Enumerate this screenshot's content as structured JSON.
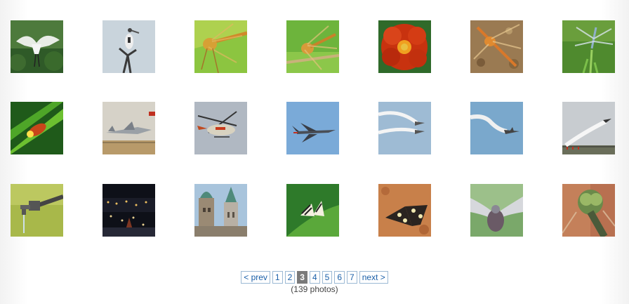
{
  "gallery": {
    "photos": [
      {
        "icon": "stork-in-flight-photo"
      },
      {
        "icon": "stork-on-branch-photo"
      },
      {
        "icon": "dragonfly-orange-photo"
      },
      {
        "icon": "dragonfly-on-twig-photo"
      },
      {
        "icon": "red-flower-photo"
      },
      {
        "icon": "dragonfly-on-soil-photo"
      },
      {
        "icon": "dragonfly-on-stem-photo"
      },
      {
        "icon": "firefly-on-leaf-photo"
      },
      {
        "icon": "jet-on-runway-photo"
      },
      {
        "icon": "helicopter-photo"
      },
      {
        "icon": "fighter-jet-photo"
      },
      {
        "icon": "jets-with-smoke-photo"
      },
      {
        "icon": "jet-smoke-trail-photo"
      },
      {
        "icon": "airshow-runway-photo"
      },
      {
        "icon": "water-tap-photo"
      },
      {
        "icon": "city-night-photo"
      },
      {
        "icon": "towers-photo"
      },
      {
        "icon": "butterfly-on-leaf-photo"
      },
      {
        "icon": "butterfly-on-ground-photo"
      },
      {
        "icon": "pigeon-photo"
      },
      {
        "icon": "dragonfly-closeup-photo"
      }
    ]
  },
  "pagination": {
    "prev_label": "< prev",
    "next_label": "next >",
    "pages": [
      "1",
      "2",
      "3",
      "4",
      "5",
      "6",
      "7"
    ],
    "current_page": "3",
    "photo_count": "(139 photos)"
  },
  "colors": {
    "link": "#1a5fa8",
    "link_border": "#9cb9d4",
    "current_page_bg": "#7a7a7a"
  }
}
